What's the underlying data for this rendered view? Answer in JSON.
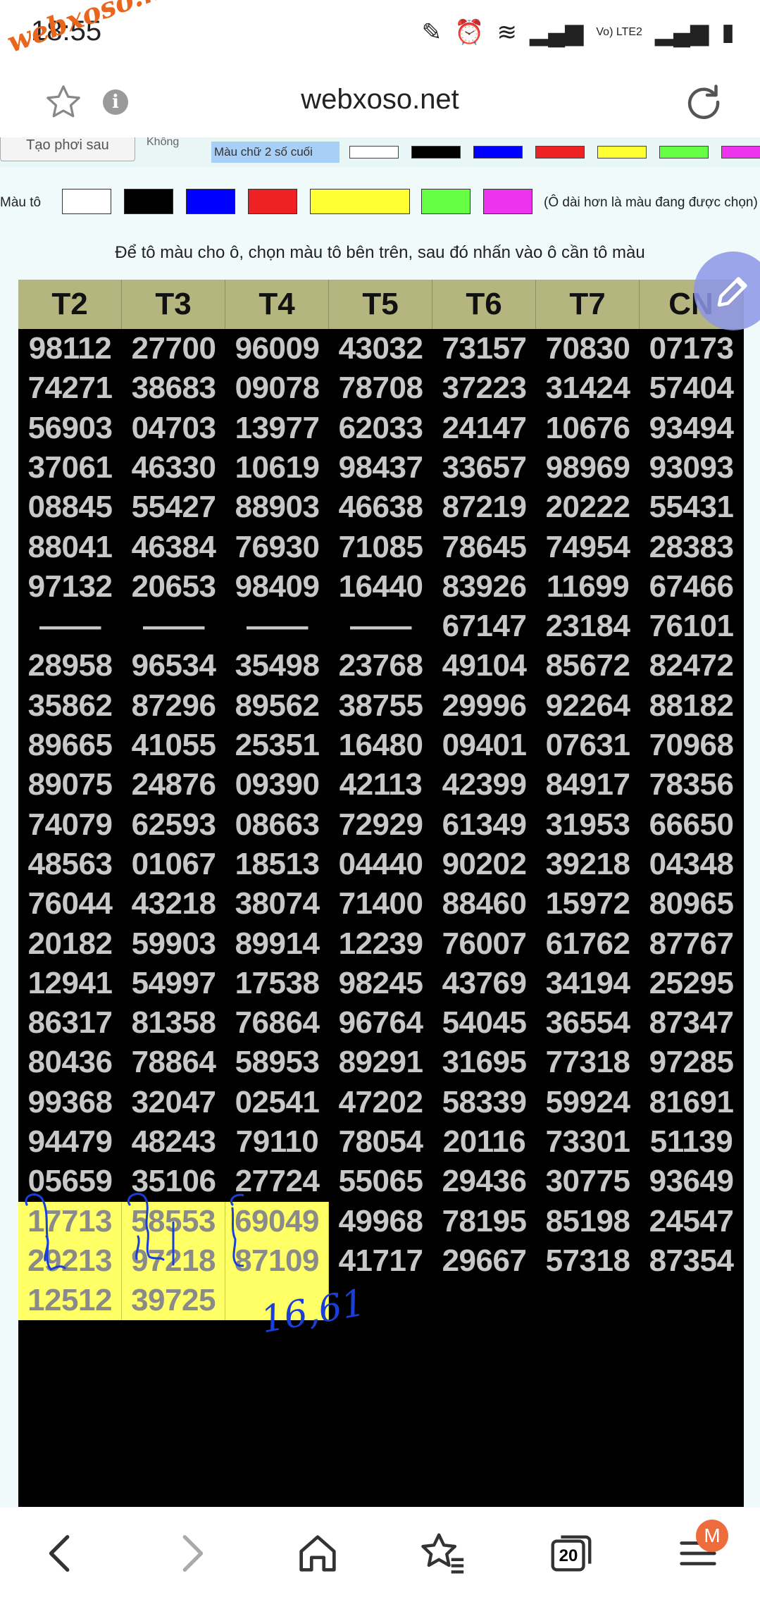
{
  "status_bar": {
    "time": "18:55",
    "watermark": "webxoso.net",
    "network": "Vo) LTE2"
  },
  "browser": {
    "url": "webxoso.net",
    "info_glyph": "i"
  },
  "text_color_row": {
    "button_label": "Tạo phơi sau",
    "none_label": "Không",
    "label": "Màu chữ 2 số cuối",
    "swatches": [
      "#ffffff",
      "#000000",
      "#0000ff",
      "#ee2222",
      "#ffff33",
      "#66ff44",
      "#ee33ee"
    ]
  },
  "fill_row": {
    "label": "Màu tô",
    "swatches": [
      "#ffffff",
      "#000000",
      "#0000ff",
      "#ee2222",
      "#ffff33",
      "#66ff44",
      "#ee33ee"
    ],
    "note": "(Ô dài hơn là màu đang được chọn)"
  },
  "instruction": "Để tô màu cho ô, chọn màu tô bên trên, sau đó nhấn vào ô cần tô màu",
  "table": {
    "headers": [
      "T2",
      "T3",
      "T4",
      "T5",
      "T6",
      "T7",
      "CN"
    ],
    "columns": [
      [
        "98112",
        "74271",
        "56903",
        "37061",
        "08845",
        "88041",
        "97132",
        "——",
        "28958",
        "35862",
        "89665",
        "89075",
        "74079",
        "48563",
        "76044",
        "20182",
        "12941",
        "86317",
        "80436",
        "99368",
        "94479",
        "05659",
        "17713",
        "29213",
        "12512"
      ],
      [
        "27700",
        "38683",
        "04703",
        "46330",
        "55427",
        "46384",
        "20653",
        "——",
        "96534",
        "87296",
        "41055",
        "24876",
        "62593",
        "01067",
        "43218",
        "59903",
        "54997",
        "81358",
        "78864",
        "32047",
        "48243",
        "35106",
        "58553",
        "97218",
        "39725"
      ],
      [
        "96009",
        "09078",
        "13977",
        "10619",
        "88903",
        "76930",
        "98409",
        "——",
        "35498",
        "89562",
        "25351",
        "09390",
        "08663",
        "18513",
        "38074",
        "89914",
        "17538",
        "76864",
        "58953",
        "02541",
        "79110",
        "27724",
        "69049",
        "87109",
        ""
      ],
      [
        "43032",
        "78708",
        "62033",
        "98437",
        "46638",
        "71085",
        "16440",
        "——",
        "23768",
        "38755",
        "16480",
        "42113",
        "72929",
        "04440",
        "71400",
        "12239",
        "98245",
        "96764",
        "89291",
        "47202",
        "78054",
        "55065",
        "49968",
        "41717"
      ],
      [
        "73157",
        "37223",
        "24147",
        "33657",
        "87219",
        "78645",
        "83926",
        "67147",
        "49104",
        "29996",
        "09401",
        "42399",
        "61349",
        "90202",
        "88460",
        "76007",
        "43769",
        "54045",
        "31695",
        "58339",
        "20116",
        "29436",
        "78195",
        "29667"
      ],
      [
        "70830",
        "31424",
        "10676",
        "98969",
        "20222",
        "74954",
        "11699",
        "23184",
        "85672",
        "92264",
        "07631",
        "84917",
        "31953",
        "39218",
        "15972",
        "61762",
        "34194",
        "36554",
        "77318",
        "59924",
        "73301",
        "30775",
        "85198",
        "57318"
      ],
      [
        "07173",
        "57404",
        "93494",
        "93093",
        "55431",
        "28383",
        "67466",
        "76101",
        "82472",
        "88182",
        "70968",
        "78356",
        "66650",
        "04348",
        "80965",
        "87767",
        "25295",
        "87347",
        "97285",
        "81691",
        "51139",
        "93649",
        "24547",
        "87354"
      ]
    ],
    "highlight_rows": [
      22,
      23,
      24
    ],
    "highlight_cols": [
      0,
      1,
      2
    ],
    "highlight_color": "#ffff66",
    "handwritten_note": "16,61"
  },
  "bottom_nav": {
    "tabs_count": "20",
    "menu_badge": "M"
  }
}
